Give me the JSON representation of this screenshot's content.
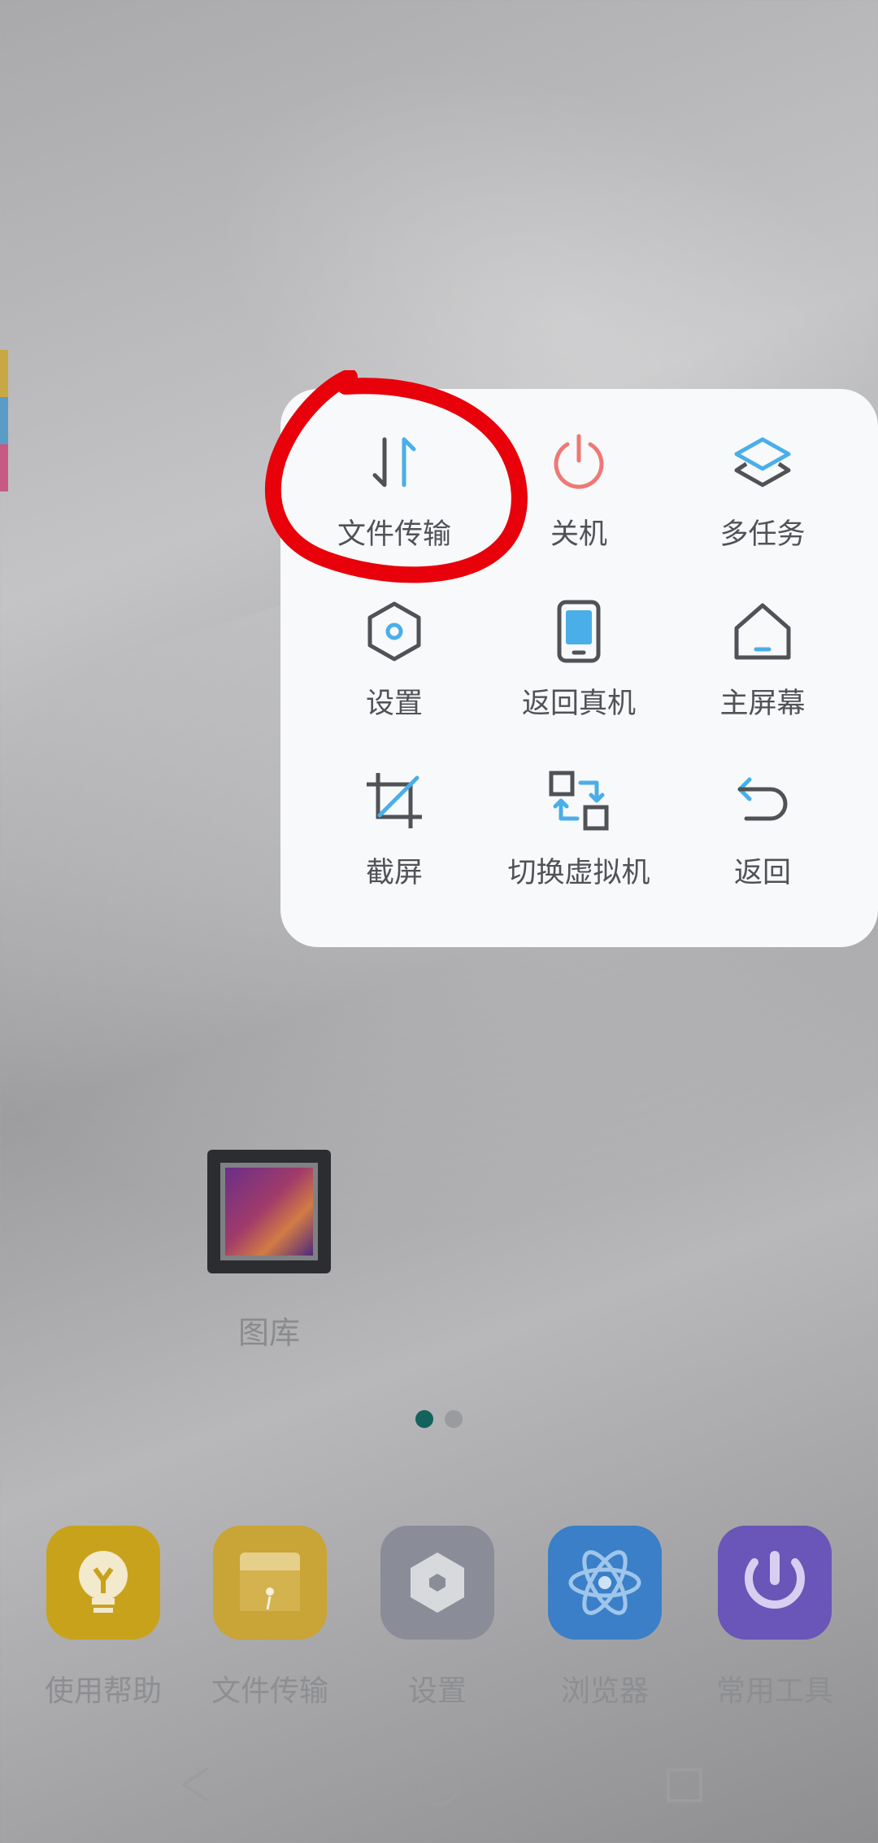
{
  "menu": {
    "items": [
      {
        "label": "文件传输",
        "icon": "file-transfer-icon"
      },
      {
        "label": "关机",
        "icon": "power-icon"
      },
      {
        "label": "多任务",
        "icon": "multitask-layers-icon"
      },
      {
        "label": "设置",
        "icon": "settings-hexagon-icon"
      },
      {
        "label": "返回真机",
        "icon": "phone-icon"
      },
      {
        "label": "主屏幕",
        "icon": "home-icon"
      },
      {
        "label": "截屏",
        "icon": "crop-screenshot-icon"
      },
      {
        "label": "切换虚拟机",
        "icon": "switch-vm-icon"
      },
      {
        "label": "返回",
        "icon": "back-arrow-icon"
      }
    ],
    "colors": {
      "blue": "#4aaee8",
      "red": "#f07874",
      "dark": "#505257"
    }
  },
  "annotation": {
    "color": "#e8000a"
  },
  "home": {
    "gallery_label": "图库",
    "dock": [
      {
        "label": "使用帮助",
        "icon": "lightbulb-icon",
        "color": "#c9a21c"
      },
      {
        "label": "文件传输",
        "icon": "folder-icon",
        "color": "#c9a436"
      },
      {
        "label": "设置",
        "icon": "settings-icon",
        "color": "#8a8d98"
      },
      {
        "label": "浏览器",
        "icon": "browser-atom-icon",
        "color": "#3a7fc8"
      },
      {
        "label": "常用工具",
        "icon": "tools-icon",
        "color": "#6a55b8"
      }
    ],
    "page_indicator": {
      "count": 2,
      "active": 1,
      "active_color": "#13625c"
    }
  },
  "nav": {
    "icons": [
      "nav-back-icon",
      "nav-home-icon",
      "nav-recent-icon"
    ]
  }
}
